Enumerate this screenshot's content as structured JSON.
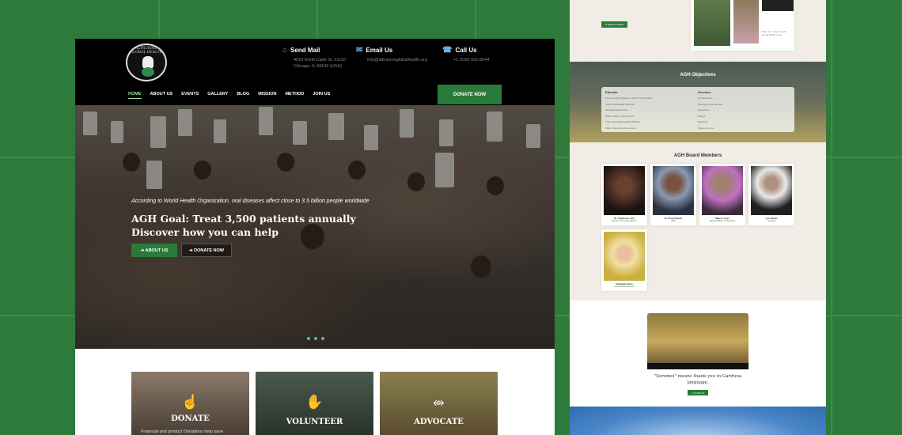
{
  "left": {
    "logo_text": "ALTRUISMO GLOBAL HEALTH",
    "contacts": [
      {
        "icon": "home-icon",
        "title": "Send Mail",
        "lines": [
          "4610 North Clark St. #1110",
          "Chicago, IL 60640 (USA)"
        ]
      },
      {
        "icon": "mail-icon",
        "title": "Email Us",
        "lines": [
          "info@altruismoglobalhealth.org"
        ]
      },
      {
        "icon": "phone-icon",
        "title": "Call Us",
        "lines": [
          "+1 (630) 551-8544"
        ]
      }
    ],
    "nav": [
      "HOME",
      "ABOUT US",
      "EVENTS",
      "GALLERY",
      "BLOG",
      "MISSION",
      "METHOD",
      "JOIN US"
    ],
    "donate_button": "DONATE NOW",
    "hero": {
      "subtitle": "According to World Health Organization, oral diseases affect close to 3.5 billion people worldwide",
      "title_line1": "AGH Goal: Treat 3,500 patients annually",
      "title_line2": "Discover how you can help",
      "btn_about": "➔ ABOUT US",
      "btn_donate": "➔ DONATE NOW"
    },
    "cards": [
      {
        "icon": "hand-pointing-icon",
        "title": "DONATE",
        "desc": "Financial and product Donations help save",
        "bg": "#6a5a4a"
      },
      {
        "icon": "raised-hand-icon",
        "title": "VOLUNTEER",
        "desc": "",
        "bg": "#3d4a3f"
      },
      {
        "icon": "share-icon",
        "title": "ADVOCATE",
        "desc": "",
        "bg": "#6a6040"
      }
    ]
  },
  "right": {
    "top_button": "➔ SEE GALLERY",
    "top_caption": "Mary, 6, is shown at the dental health event.",
    "objectives": {
      "title": "AGH Objectives",
      "educate_title": "Educate",
      "educate": [
        "Promote Oral Hygiene in Rural Communities",
        "Teach Oral Health Practices",
        "Distribute Dental Kits",
        "Partner With Local Schools",
        "Train Community Health Workers",
        "Share Prevention Resources"
      ],
      "services_title": "Services",
      "services": [
        "Dental Exams",
        "Cleanings and Fluoride",
        "Extractions",
        "Fillings",
        "Referrals",
        "Follow-Up Care"
      ]
    },
    "board": {
      "title": "AGH Board Members",
      "members": [
        {
          "name": "Dr. Stephanie Joly",
          "role": "Founder / Executive Director",
          "bg": "#3a2a22"
        },
        {
          "name": "Dr. Floyd Banks",
          "role": "CEO",
          "bg": "#5a6a8a"
        },
        {
          "name": "Mikey Lopez",
          "role": "Medical Officer of Operations",
          "bg": "#6a4a6a"
        },
        {
          "name": "Luis Marin",
          "role": "Secretary",
          "bg": "#c8c8c8"
        },
        {
          "name": "Rebekah Davis",
          "role": "Social Media Outreach",
          "bg": "#c9b040"
        }
      ]
    },
    "video": {
      "caption_line1": "\"Seremei\" means thank you in Garifuna",
      "caption_line2": "language.",
      "button": "➔ JOIN US"
    }
  }
}
